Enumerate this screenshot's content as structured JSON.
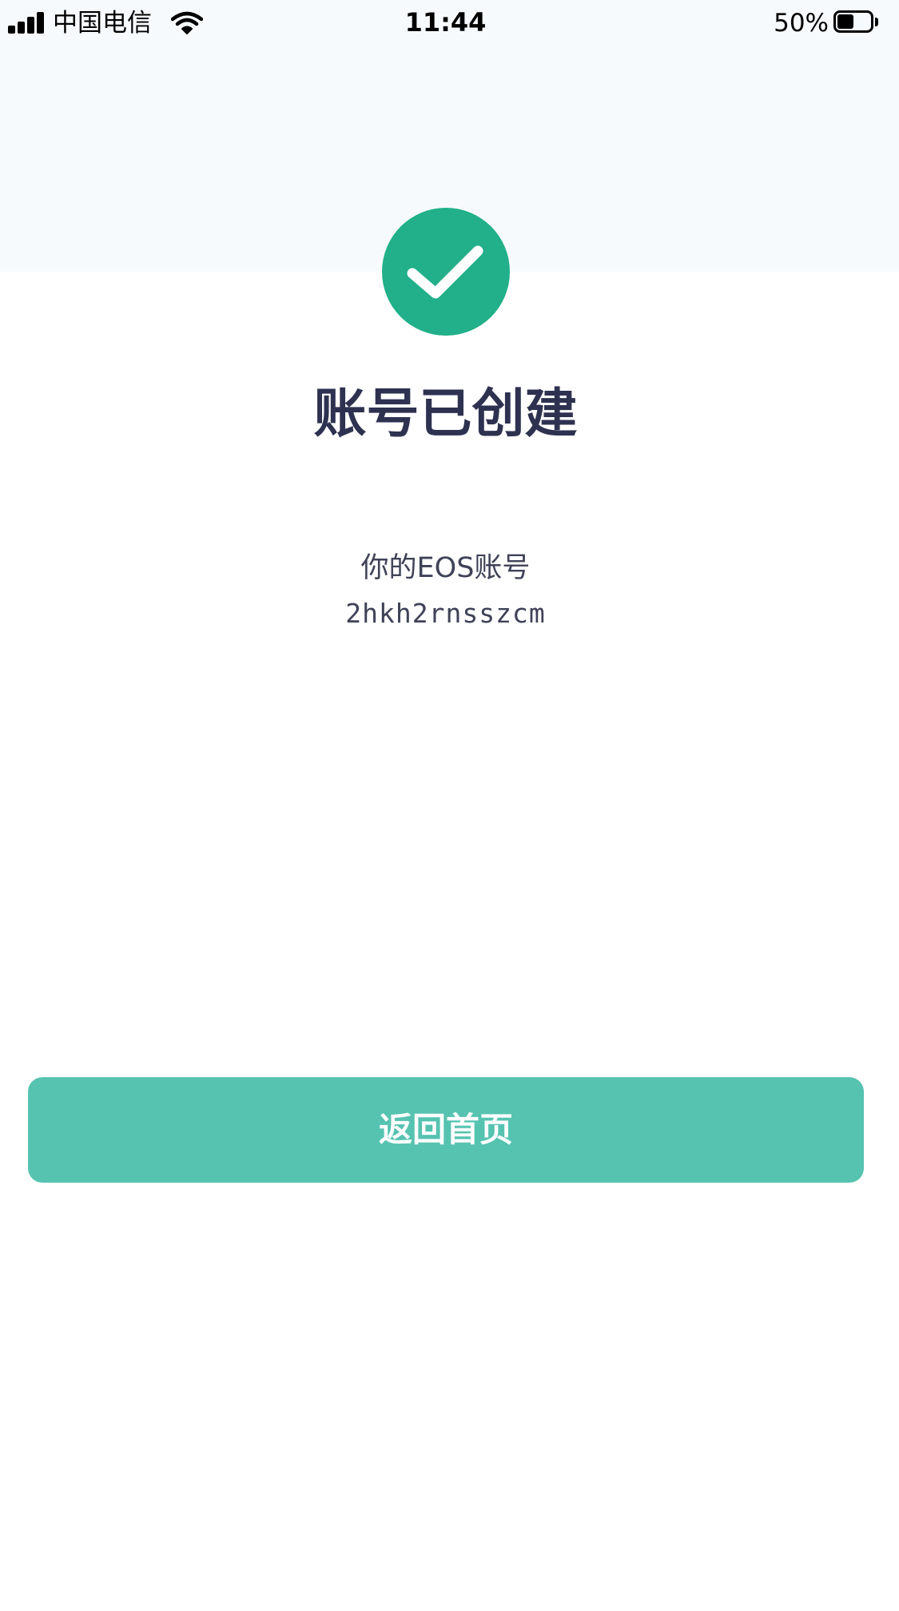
{
  "status_bar": {
    "carrier": "中国电信",
    "time": "11:44",
    "battery_percent": "50%",
    "battery_level": 0.5,
    "signal_icon": "signal-bars-icon",
    "wifi_icon": "wifi-icon",
    "battery_icon": "battery-icon"
  },
  "success": {
    "icon": "checkmark-circle-icon",
    "icon_color": "#21b089",
    "title": "账号已创建"
  },
  "account": {
    "label": "你的EOS账号",
    "name": "2hkh2rnsszcm"
  },
  "actions": {
    "home_button_label": "返回首页",
    "button_color": "#56c3b0"
  }
}
